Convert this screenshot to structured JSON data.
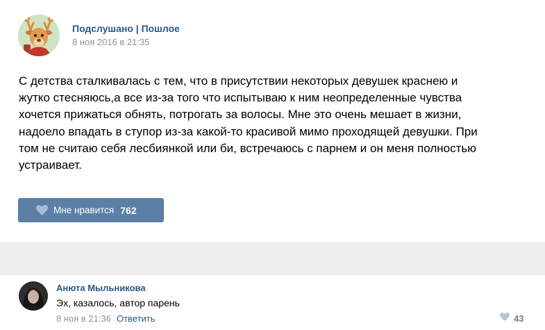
{
  "post": {
    "author": "Подслушано | Пошлое",
    "date": "8 ноя 2016 в 21:35",
    "text_lines": [
      "С детства сталкивалась с тем, что в присутствии некоторых девушек краснею и",
      "жутко стесняюсь,а все из-за того что испытываю к ним неопределенные чувства",
      "хочется прижаться обнять, потрогать за волосы. Мне это очень мешает в жизни,",
      "надоело впадать в ступор из-за какой-то красивой мимо проходящей девушки. При",
      "том не считаю себя лесбиянкой или би, встречаюсь с парнем и он меня полностью",
      "устраивает."
    ],
    "like_label": "Мне нравится",
    "like_count": "762"
  },
  "comment": {
    "author": "Анюта Мыльникова",
    "text": "Эх, казалось, автор парень",
    "date": "8 ноя в 21:36",
    "reply_label": "Ответить",
    "like_count": "43"
  },
  "colors": {
    "link": "#2a5885",
    "button": "#5b7fa6",
    "separator": "#edeef0",
    "meta": "#939393"
  }
}
